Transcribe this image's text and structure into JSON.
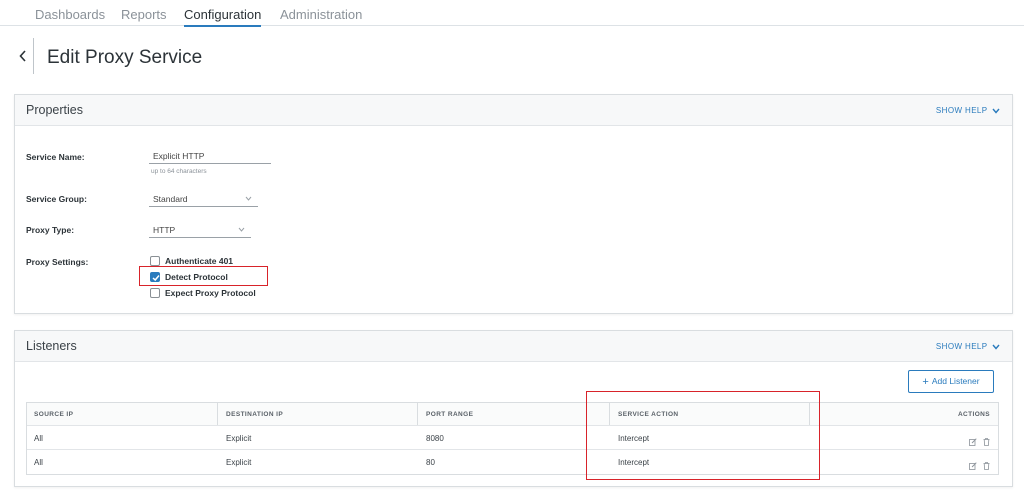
{
  "nav": {
    "tabs": [
      {
        "label": "Dashboards"
      },
      {
        "label": "Reports"
      },
      {
        "label": "Configuration",
        "active": true
      },
      {
        "label": "Administration"
      }
    ]
  },
  "header": {
    "back_icon": "chevron-left-icon",
    "title": "Edit Proxy Service"
  },
  "properties": {
    "title": "Properties",
    "show_help": "SHOW HELP",
    "service_name": {
      "label": "Service Name:",
      "value": "Explicit HTTP",
      "hint": "up to 64 characters"
    },
    "service_group": {
      "label": "Service Group:",
      "value": "Standard"
    },
    "proxy_type": {
      "label": "Proxy Type:",
      "value": "HTTP"
    },
    "proxy_settings": {
      "label": "Proxy Settings:",
      "options": [
        {
          "label": "Authenticate 401",
          "checked": false
        },
        {
          "label": "Detect Protocol",
          "checked": true
        },
        {
          "label": "Expect Proxy Protocol",
          "checked": false
        }
      ]
    }
  },
  "listeners": {
    "title": "Listeners",
    "show_help": "SHOW HELP",
    "add_button": "Add Listener",
    "columns": [
      "SOURCE IP",
      "DESTINATION IP",
      "PORT RANGE",
      "SERVICE ACTION",
      "ACTIONS"
    ],
    "rows": [
      {
        "source_ip": "All",
        "destination_ip": "Explicit",
        "port_range": "8080",
        "service_action": "Intercept"
      },
      {
        "source_ip": "All",
        "destination_ip": "Explicit",
        "port_range": "80",
        "service_action": "Intercept"
      }
    ]
  },
  "colors": {
    "accent": "#2a7bbd",
    "highlight": "#d8232a"
  }
}
